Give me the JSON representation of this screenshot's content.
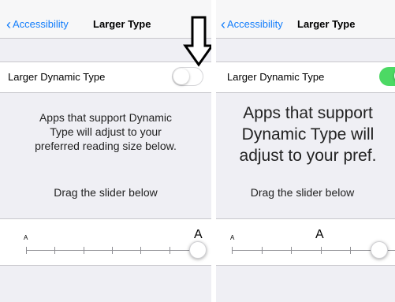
{
  "left": {
    "nav": {
      "back_label": "Accessibility",
      "title": "Larger Type"
    },
    "setting_label": "Larger Dynamic Type",
    "toggle_on": false,
    "description": [
      "Apps that support Dynamic",
      "Type will adjust to your",
      "preferred reading size below."
    ],
    "drag_hint": "Drag the slider below",
    "slider": {
      "small_label": "A",
      "large_label": "A",
      "value_fraction": 1.0,
      "steps": 7
    }
  },
  "right": {
    "nav": {
      "back_label": "Accessibility",
      "title": "Larger Type"
    },
    "setting_label": "Larger Dynamic Type",
    "toggle_on": true,
    "description": [
      "Apps that support",
      "Dynamic Type will",
      "adjust to your pref."
    ],
    "drag_hint": "Drag the slider below",
    "slider": {
      "small_label": "A",
      "large_label": "A",
      "value_fraction": 0.83,
      "steps": 7
    }
  },
  "colors": {
    "accent": "#147efb",
    "toggle_on": "#4cd964",
    "background": "#efeff4"
  },
  "annotation": {
    "icon": "down-arrow-icon"
  }
}
